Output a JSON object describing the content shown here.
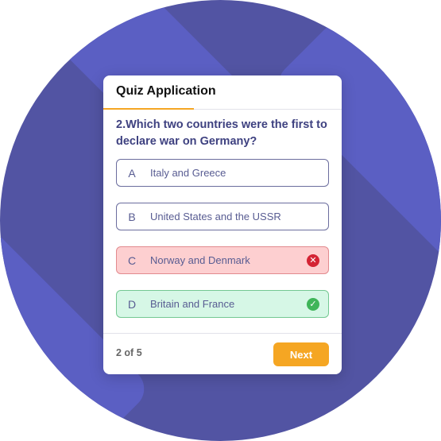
{
  "app": {
    "title": "Quiz Application",
    "progress_fraction": 0.38
  },
  "question": {
    "text": "2.Which two countries were the first to declare war on Germany?"
  },
  "options": [
    {
      "letter": "A",
      "text": "Italy and Greece",
      "state": "default"
    },
    {
      "letter": "B",
      "text": "United States and the USSR",
      "state": "default"
    },
    {
      "letter": "C",
      "text": "Norway and Denmark",
      "state": "wrong",
      "icon": "close-icon"
    },
    {
      "letter": "D",
      "text": "Britain and France",
      "state": "right",
      "icon": "check-icon"
    }
  ],
  "footer": {
    "counter": "2 of 5",
    "next_label": "Next"
  },
  "colors": {
    "background": "#5254a3",
    "accent": "#f5a623",
    "wrong": "#d42434",
    "right": "#3fb559"
  }
}
